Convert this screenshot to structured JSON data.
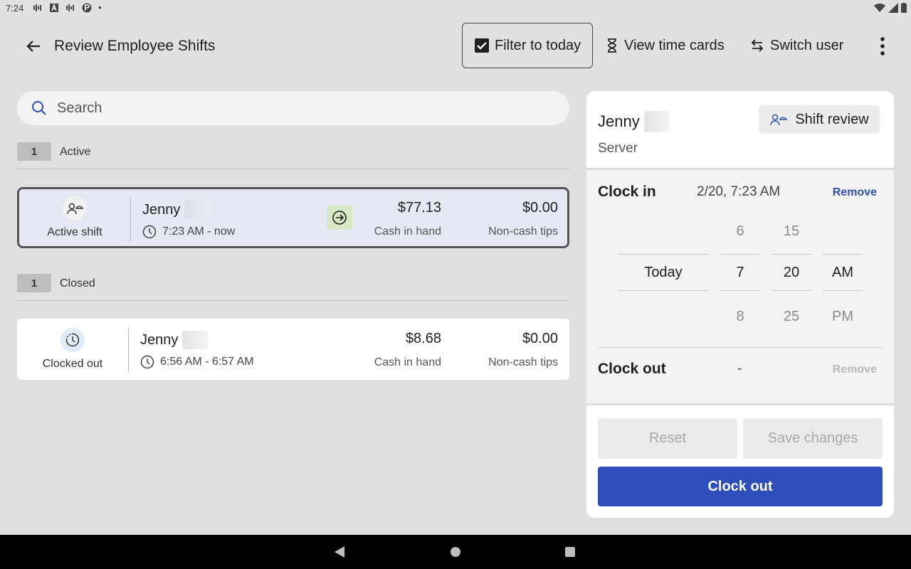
{
  "status_bar": {
    "time": "7:24",
    "dot": "•"
  },
  "header": {
    "title": "Review Employee Shifts",
    "filter_label": "Filter to today",
    "view_time_cards_label": "View time cards",
    "switch_user_label": "Switch user"
  },
  "search": {
    "placeholder": "Search",
    "value": ""
  },
  "sections": [
    {
      "count": "1",
      "label": "Active"
    },
    {
      "count": "1",
      "label": "Closed"
    }
  ],
  "shifts": [
    {
      "status": "Active shift",
      "name": "Jenny",
      "time_range": "7:23 AM - now",
      "cash": "$77.13",
      "cash_label": "Cash in hand",
      "tips": "$0.00",
      "tips_label": "Non-cash tips"
    },
    {
      "status": "Clocked out",
      "name": "Jenny",
      "time_range": "6:56 AM - 6:57 AM",
      "cash": "$8.68",
      "cash_label": "Cash in hand",
      "tips": "$0.00",
      "tips_label": "Non-cash tips"
    }
  ],
  "detail": {
    "name": "Jenny",
    "role": "Server",
    "shift_review_label": "Shift review",
    "clock_in_label": "Clock in",
    "clock_in_value": "2/20, 7:23 AM",
    "remove_label": "Remove",
    "picker": {
      "day": {
        "selected": "Today"
      },
      "hour": {
        "prev": "6",
        "selected": "7",
        "next": "8"
      },
      "minute": {
        "prev": "15",
        "selected": "20",
        "next": "25"
      },
      "period": {
        "selected": "AM",
        "next": "PM"
      }
    },
    "clock_out_label": "Clock out",
    "clock_out_value": "-",
    "remove_out_label": "Remove",
    "reset_label": "Reset",
    "save_label": "Save changes",
    "clock_out_button_label": "Clock out"
  },
  "colors": {
    "primary": "#2c4fbb",
    "active_card_bg": "#e6e8f4",
    "clock_in_icon_bg": "#d7e8c5"
  }
}
